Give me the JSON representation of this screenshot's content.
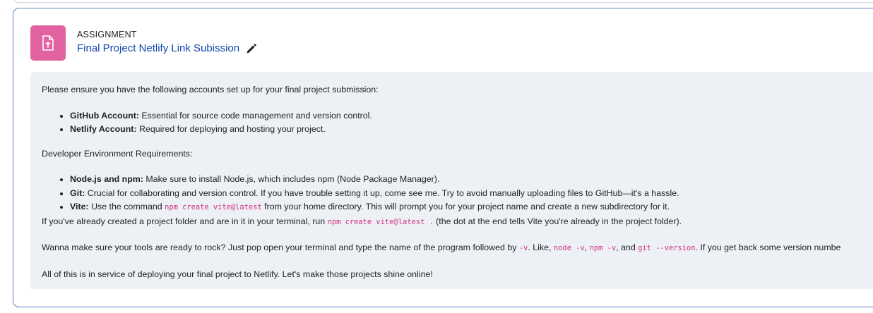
{
  "activity": {
    "type_label": "ASSIGNMENT",
    "title": "Final Project Netlify Link Subission",
    "icon": "assignment-upload-icon",
    "edit_icon": "pencil-icon",
    "icon_color": "#e2619f",
    "title_color": "#0f47ad"
  },
  "description": {
    "intro": "Please ensure you have the following accounts set up for your final project submission:",
    "accounts": [
      {
        "label": "GitHub Account:",
        "text": " Essential for source code management and version control."
      },
      {
        "label": "Netlify Account:",
        "text": " Required for deploying and hosting your project."
      }
    ],
    "env_heading": "Developer Environment Requirements:",
    "requirements": [
      {
        "label": "Node.js and npm:",
        "text": " Make sure to install Node.js, which includes npm (Node Package Manager)."
      },
      {
        "label": "Git:",
        "text": " Crucial for collaborating and version control. If you have trouble setting it up, come see me. Try to avoid manually uploading files to GitHub—it's a hassle."
      },
      {
        "label": "Vite:",
        "text_before": " Use the command ",
        "code": "npm create vite@latest",
        "text_after": " from your home directory. This will prompt you for your project name and create a new subdirectory for it."
      }
    ],
    "folder_note": {
      "before": "If you've already created a project folder and are in it in your terminal, run ",
      "code": "npm create vite@latest .",
      "after": " (the dot at the end tells Vite you're already in the project folder)."
    },
    "check_tools": {
      "part1": "Wanna make sure your tools are ready to rock? Just pop open your terminal and type the name of the program followed by ",
      "code1": "-v",
      "part2": ". Like, ",
      "code2": "node -v",
      "part3": ", ",
      "code3": "npm -v",
      "part4": ", and ",
      "code4": "git --version",
      "part5": ". If you get back some version numbe"
    },
    "closing": "All of this is in service of deploying your final project to Netlify. Let's make those projects shine online!"
  }
}
